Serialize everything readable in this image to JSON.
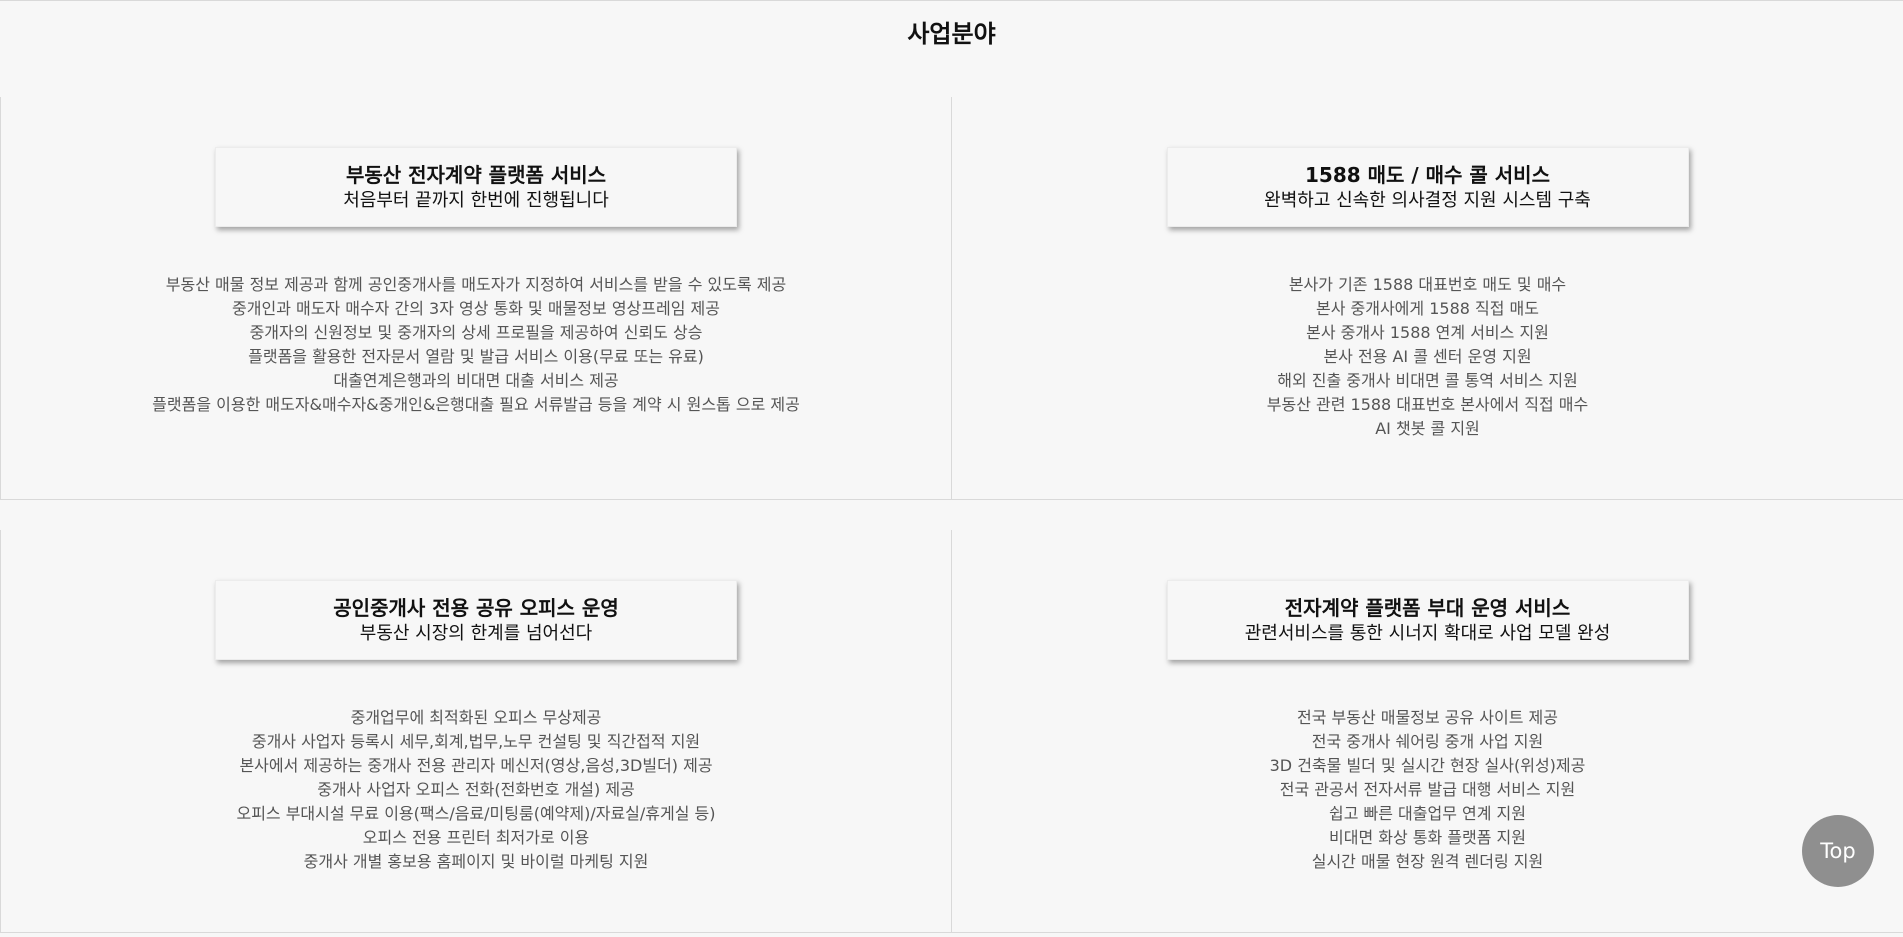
{
  "page": {
    "title": "사업분야"
  },
  "sections": [
    {
      "title": "부동산 전자계약 플랫폼 서비스",
      "subtitle": "처음부터 끝까지 한번에 진행됩니다",
      "items": [
        "부동산 매물 정보 제공과 함께 공인중개사를 매도자가 지정하여 서비스를 받을 수 있도록 제공",
        "중개인과 매도자 매수자 간의 3자 영상 통화 및 매물정보 영상프레임 제공",
        "중개자의 신원정보 및 중개자의 상세 프로필을 제공하여 신뢰도 상승",
        "플랫폼을 활용한 전자문서 열람 및 발급 서비스 이용(무료 또는 유료)",
        "대출연계은행과의 비대면 대출 서비스 제공",
        "플랫폼을 이용한 매도자&매수자&중개인&은행대출 필요 서류발급 등을 계약 시 원스톱 으로 제공"
      ]
    },
    {
      "title": "1588 매도 / 매수 콜 서비스",
      "subtitle": "완벽하고 신속한 의사결정 지원 시스템 구축",
      "items": [
        "본사가 기존 1588 대표번호 매도 및 매수",
        "본사 중개사에게 1588 직접 매도",
        "본사 중개사 1588 연계 서비스 지원",
        "본사 전용 AI 콜 센터 운영 지원",
        "해외 진출 중개사 비대면 콜 통역 서비스 지원",
        "부동산 관련 1588 대표번호 본사에서 직접 매수",
        "AI 챗봇 콜 지원"
      ]
    },
    {
      "title": "공인중개사 전용 공유 오피스 운영",
      "subtitle": "부동산 시장의 한계를 넘어선다",
      "items": [
        "중개업무에 최적화된 오피스 무상제공",
        "중개사 사업자 등록시 세무,회계,법무,노무 컨설팅 및 직간접적 지원",
        "본사에서 제공하는 중개사 전용 관리자 메신저(영상,음성,3D빌더) 제공",
        "중개사 사업자 오피스 전화(전화번호 개설) 제공",
        "오피스 부대시설 무료 이용(팩스/음료/미팅룸(예약제)/자료실/휴게실 등)",
        "오피스 전용 프린터 최저가로 이용",
        "중개사 개별 홍보용 홈페이지 및 바이럴 마케팅 지원"
      ]
    },
    {
      "title": "전자계약 플랫폼 부대 운영 서비스",
      "subtitle": "관련서비스를 통한 시너지 확대로 사업 모델 완성",
      "items": [
        "전국 부동산 매물정보 공유 사이트 제공",
        "전국 중개사 쉐어링 중개 사업 지원",
        "3D 건축물 빌더 및 실시간 현장 실사(위성)제공",
        "전국 관공서 전자서류 발급 대행 서비스 지원",
        "쉽고 빠른 대출업무 연계 지원",
        "비대면 화상 통화 플랫폼 지원",
        "실시간 매물 현장 원격 렌더링 지원"
      ]
    }
  ],
  "top_button": {
    "label": "Top"
  }
}
